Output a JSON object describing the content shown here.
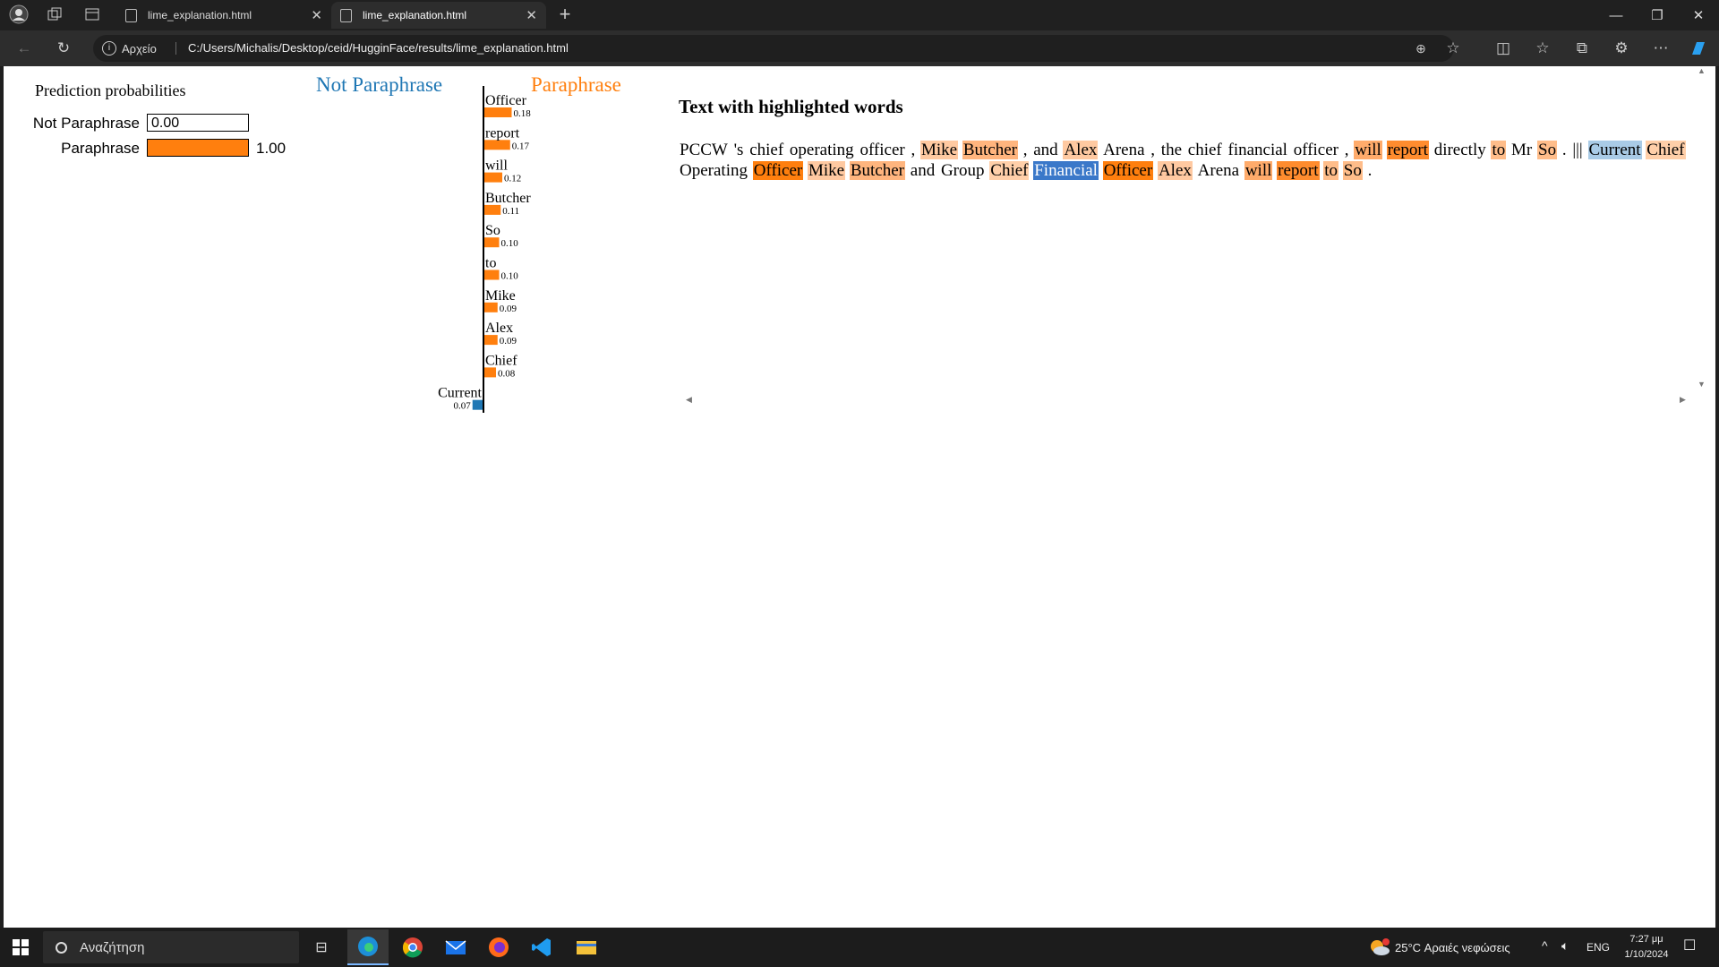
{
  "browser": {
    "tabs": [
      {
        "title": "lime_explanation.html"
      },
      {
        "title": "lime_explanation.html"
      }
    ],
    "site_info_label": "Αρχείο",
    "url": "C:/Users/Michalis/Desktop/ceid/HugginFace/results/lime_explanation.html"
  },
  "prediction": {
    "title": "Prediction probabilities",
    "classes": [
      {
        "label": "Not Paraphrase",
        "value": "0.00",
        "fraction": 0.0,
        "color": "#1f77b4"
      },
      {
        "label": "Paraphrase",
        "value": "1.00",
        "fraction": 1.0,
        "color": "#ff7f0e"
      }
    ]
  },
  "class_headers": {
    "negative": "Not Paraphrase",
    "positive": "Paraphrase"
  },
  "chart_data": {
    "type": "bar",
    "categories": [
      "Officer",
      "report",
      "will",
      "Butcher",
      "So",
      "to",
      "Mike",
      "Alex",
      "Chief",
      "Current"
    ],
    "values": [
      0.18,
      0.17,
      0.12,
      0.11,
      0.1,
      0.1,
      0.09,
      0.09,
      0.08,
      -0.07
    ],
    "value_labels": [
      "0.18",
      "0.17",
      "0.12",
      "0.11",
      "0.10",
      "0.10",
      "0.09",
      "0.09",
      "0.08",
      "0.07"
    ],
    "colors": {
      "positive": "#ff7f0e",
      "negative": "#1f77b4"
    },
    "orientation": "horizontal",
    "title": "",
    "xlabel": "",
    "ylabel": ""
  },
  "highlighted_text": {
    "title": "Text with highlighted words",
    "tokens": [
      {
        "t": "PCCW",
        "h": ""
      },
      {
        "t": "'s",
        "h": ""
      },
      {
        "t": "chief",
        "h": ""
      },
      {
        "t": "operating",
        "h": ""
      },
      {
        "t": "officer",
        "h": ""
      },
      {
        "t": ",",
        "h": ""
      },
      {
        "t": "Mike",
        "h": "#ffc9a1"
      },
      {
        "t": "Butcher",
        "h": "#ffb57e"
      },
      {
        "t": ",",
        "h": ""
      },
      {
        "t": "and",
        "h": ""
      },
      {
        "t": "Alex",
        "h": "#ffc9a1"
      },
      {
        "t": "Arena",
        "h": ""
      },
      {
        "t": ",",
        "h": ""
      },
      {
        "t": "the",
        "h": ""
      },
      {
        "t": "chief",
        "h": ""
      },
      {
        "t": "financial",
        "h": ""
      },
      {
        "t": "officer",
        "h": ""
      },
      {
        "t": ",",
        "h": ""
      },
      {
        "t": "will",
        "h": "#ffab6b"
      },
      {
        "t": "report",
        "h": "#ff8c2e"
      },
      {
        "t": "directly",
        "h": ""
      },
      {
        "t": "to",
        "h": "#ffbd8a"
      },
      {
        "t": "Mr",
        "h": ""
      },
      {
        "t": "So",
        "h": "#ffbd8a"
      },
      {
        "t": ".",
        "h": ""
      },
      {
        "t": "|||",
        "h": ""
      },
      {
        "t": "Current",
        "h": "#a9cbe6"
      },
      {
        "t": "Chief",
        "h": "#ffcfa9"
      },
      {
        "t": "Operating",
        "h": ""
      },
      {
        "t": "Officer",
        "h": "#ff7f0e"
      },
      {
        "t": "Mike",
        "h": "#ffc9a1"
      },
      {
        "t": "Butcher",
        "h": "#ffb57e"
      },
      {
        "t": "and",
        "h": ""
      },
      {
        "t": "Group",
        "h": ""
      },
      {
        "t": "Chief",
        "h": "#ffcfa9"
      },
      {
        "t": "Financial",
        "h": "#3a78c9",
        "fg": "#ffffff"
      },
      {
        "t": "Officer",
        "h": "#ff7f0e"
      },
      {
        "t": "Alex",
        "h": "#ffc9a1"
      },
      {
        "t": "Arena",
        "h": ""
      },
      {
        "t": "will",
        "h": "#ffab6b"
      },
      {
        "t": "report",
        "h": "#ff8c2e"
      },
      {
        "t": "to",
        "h": "#ffbd8a"
      },
      {
        "t": "So",
        "h": "#ffbd8a"
      },
      {
        "t": ".",
        "h": ""
      }
    ]
  },
  "taskbar": {
    "search_placeholder": "Αναζήτηση",
    "weather": "25°C  Αραιές νεφώσεις",
    "language": "ENG",
    "time": "7:27 μμ",
    "date": "1/10/2024"
  }
}
